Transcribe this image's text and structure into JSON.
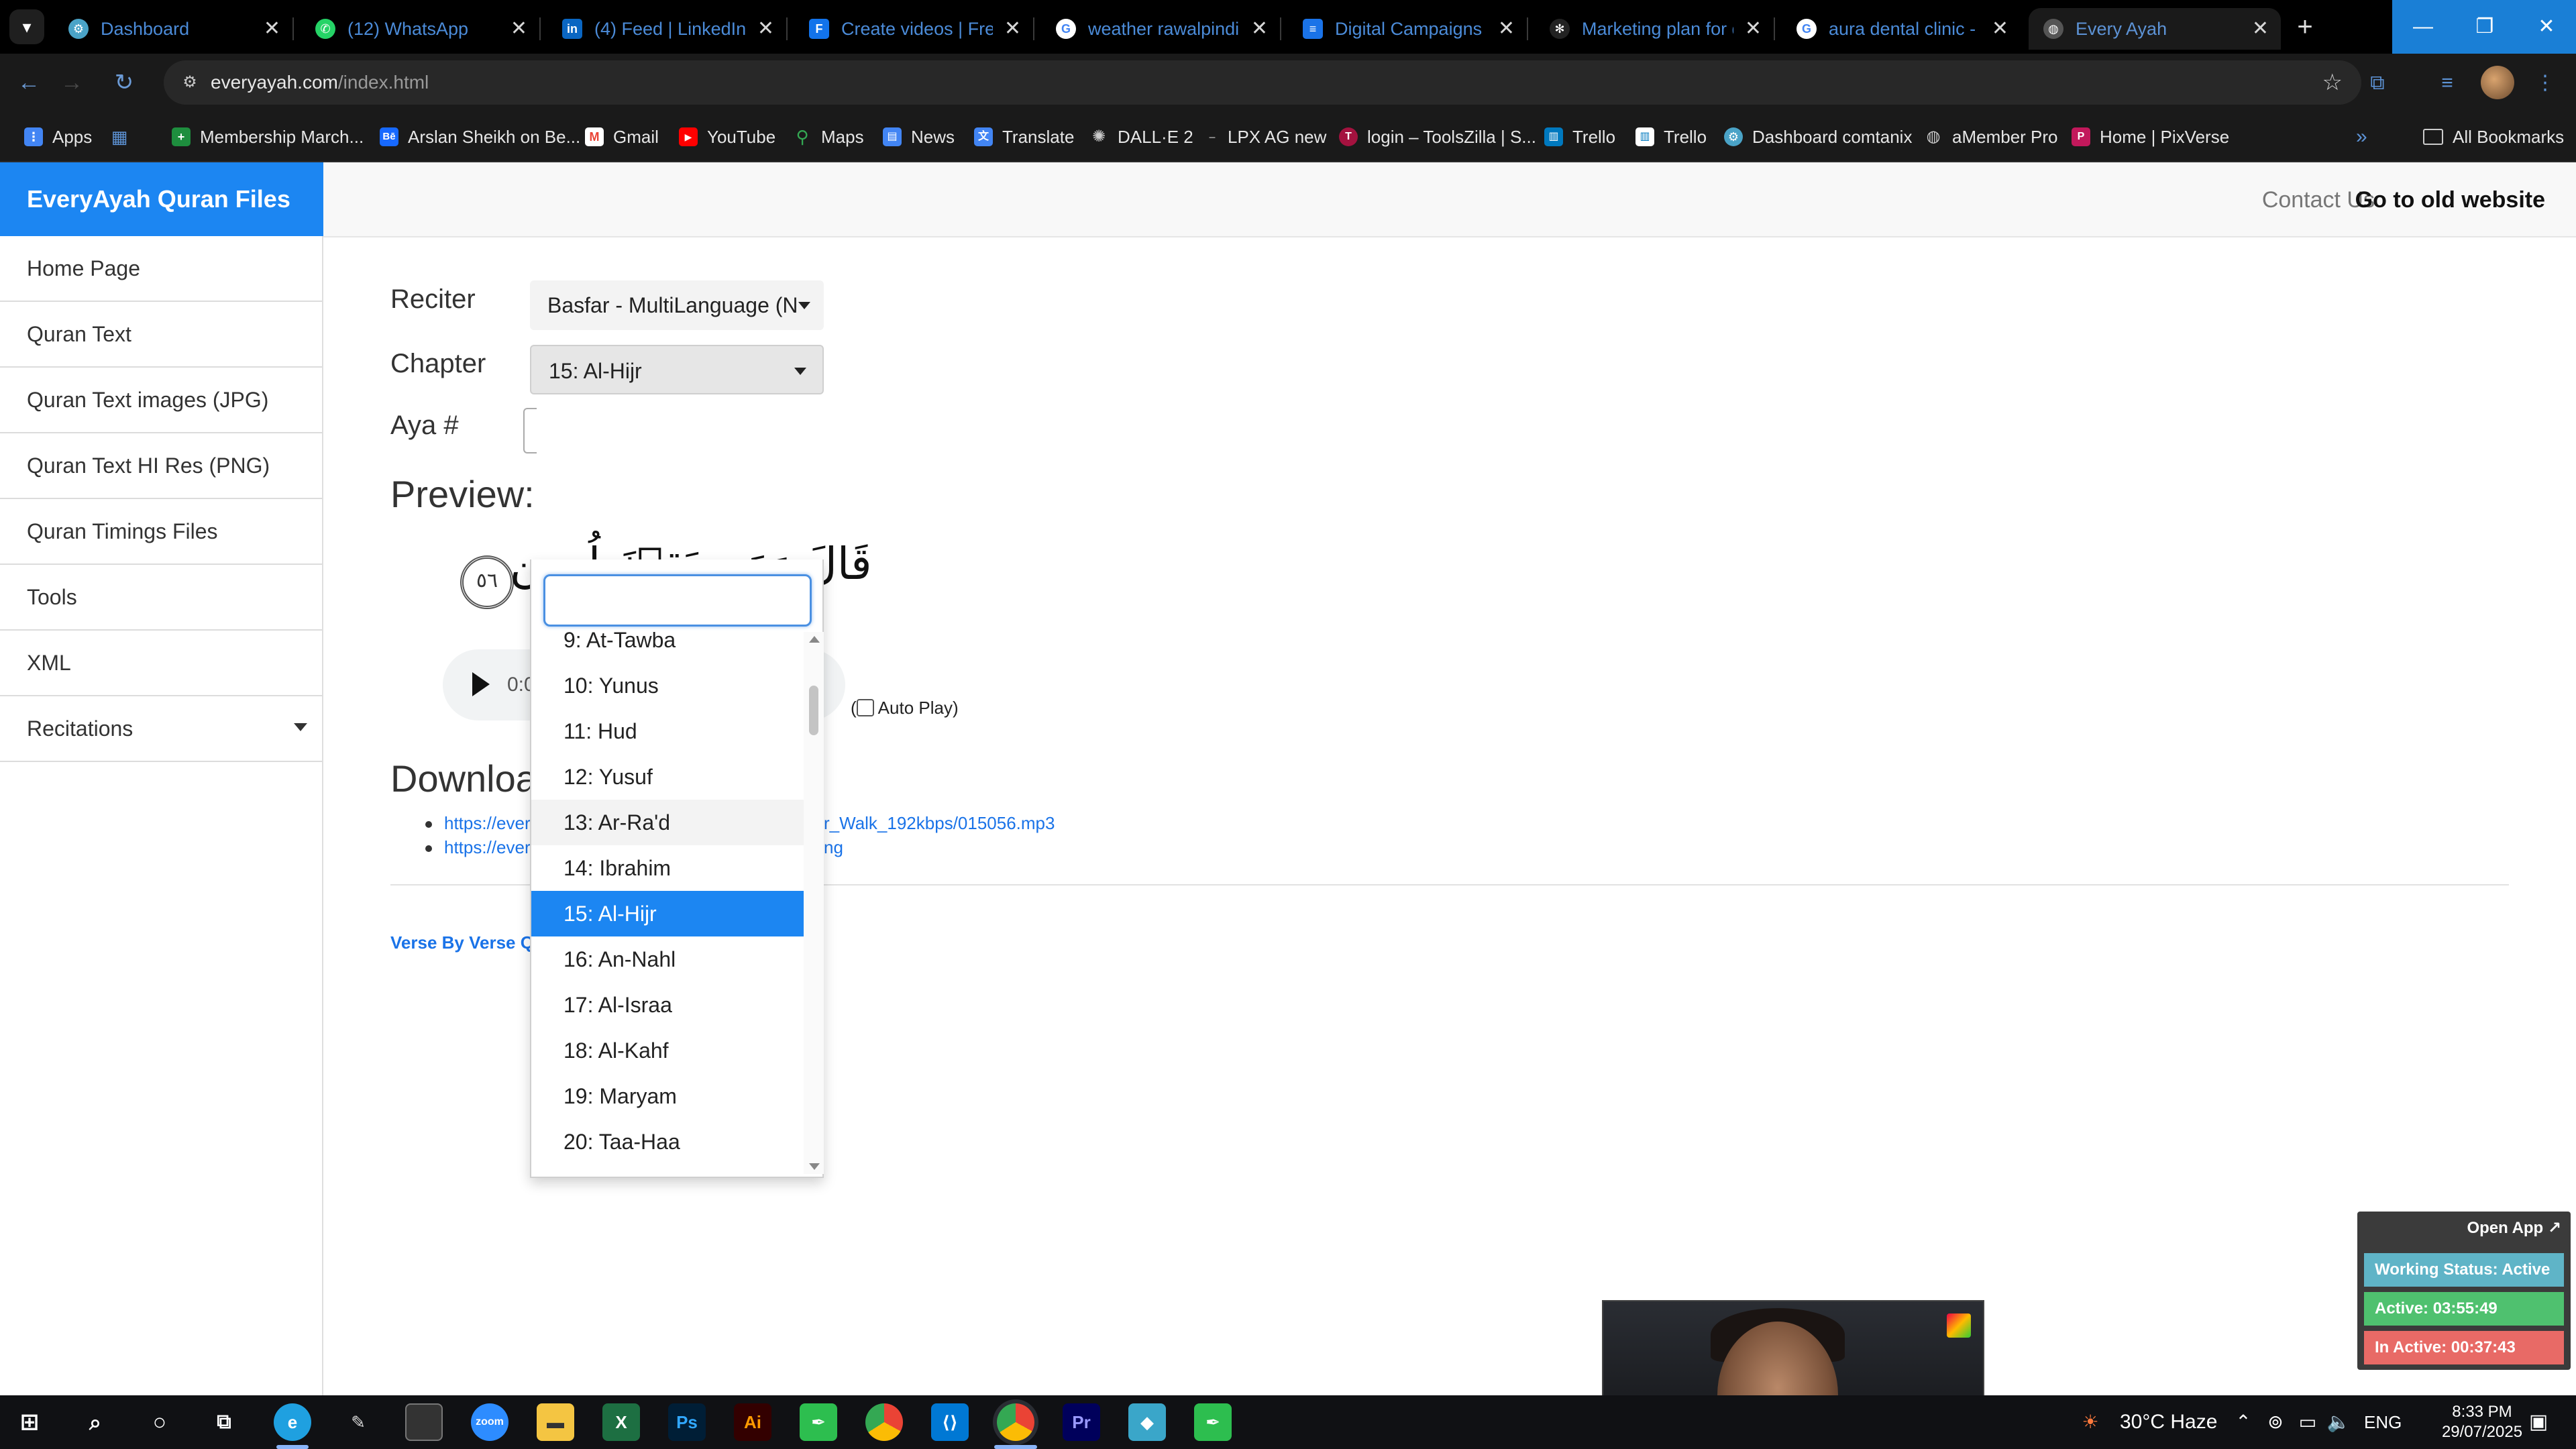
{
  "browser": {
    "tabs": [
      {
        "title": "Dashboard",
        "icon": "gear-icon",
        "color": "#4aa3c7"
      },
      {
        "title": "(12) WhatsApp",
        "icon": "whatsapp-icon",
        "color": "#25d366"
      },
      {
        "title": "(4) Feed | LinkedIn",
        "icon": "linkedin-icon",
        "color": "#0a66c2"
      },
      {
        "title": "Create videos | Freep",
        "icon": "freepik-icon",
        "color": "#1273eb"
      },
      {
        "title": "weather rawalpindi to",
        "icon": "google-icon",
        "color": "#4285f4"
      },
      {
        "title": "Digital Campaigns vs",
        "icon": "docs-icon",
        "color": "#1a73e8"
      },
      {
        "title": "Marketing plan for di",
        "icon": "openai-icon",
        "color": "#222222"
      },
      {
        "title": "aura dental clinic - G",
        "icon": "google-icon",
        "color": "#4285f4"
      },
      {
        "title": "Every Ayah",
        "icon": "globe-icon",
        "color": "#555555"
      }
    ],
    "url_host": "everyayah.com",
    "url_path": "/index.html",
    "bookmarks": [
      {
        "label": "Apps",
        "icon": "apps-icon",
        "color": "#4285f4"
      },
      {
        "label": "",
        "icon": "grid-icon",
        "color": "#5d93d6"
      },
      {
        "label": "Membership March...",
        "icon": "plus-icon",
        "color": "#1e8e3e"
      },
      {
        "label": "Arslan Sheikh on Be...",
        "icon": "behance-icon",
        "color": "#1769ff"
      },
      {
        "label": "Gmail",
        "icon": "gmail-icon",
        "color": "#ea4335"
      },
      {
        "label": "YouTube",
        "icon": "youtube-icon",
        "color": "#ff0000"
      },
      {
        "label": "Maps",
        "icon": "maps-icon",
        "color": "#34a853"
      },
      {
        "label": "News",
        "icon": "news-icon",
        "color": "#4285f4"
      },
      {
        "label": "Translate",
        "icon": "translate-icon",
        "color": "#4285f4"
      },
      {
        "label": "DALL·E 2",
        "icon": "dalle-icon",
        "color": "#444444"
      },
      {
        "label": "LPX AG new",
        "icon": "dash-icon",
        "color": "#333333"
      },
      {
        "label": "login – ToolsZilla | S...",
        "icon": "toolszilla-icon",
        "color": "#a4123f"
      },
      {
        "label": "Trello",
        "icon": "trello-icon",
        "color": "#0079bf"
      },
      {
        "label": "Trello",
        "icon": "trello-icon",
        "color": "#ffffff"
      },
      {
        "label": "Dashboard comtanix",
        "icon": "gear-icon",
        "color": "#4aa3c7"
      },
      {
        "label": "aMember Pro",
        "icon": "globe-icon",
        "color": "#666666"
      },
      {
        "label": "Home | PixVerse",
        "icon": "pixverse-icon",
        "color": "#c2185b"
      }
    ],
    "all_bookmarks": "All Bookmarks"
  },
  "site": {
    "brand": "EveryAyah Quran Files",
    "contact": "Contact Us",
    "old_site": "Go to old website",
    "sidebar": [
      "Home Page",
      "Quran Text",
      "Quran Text images (JPG)",
      "Quran Text HI Res (PNG)",
      "Quran Timings Files",
      "Tools",
      "XML",
      "Recitations"
    ]
  },
  "form": {
    "reciter_label": "Reciter",
    "reciter_value": "Basfar - MultiLanguage (N",
    "chapter_label": "Chapter",
    "chapter_value": "15: Al-Hijr",
    "aya_label": "Aya #"
  },
  "preview": {
    "heading": "Preview:",
    "arabic": "قَالَ وَمَن يَقۡنَطُ مِن",
    "verse_number": "٥٦",
    "audio_time": "0:0",
    "autoplay_label": "Auto Play)",
    "autoplay_open_paren": "("
  },
  "downloads": {
    "heading": "Downloa",
    "links": [
      {
        "left": "https://ever",
        "right": "r_Walk_192kbps/015056.mp3"
      },
      {
        "left": "https://ever",
        "right": "ng"
      }
    ],
    "verse_by_verse": "Verse By Verse Q"
  },
  "dropdown": {
    "search_value": "",
    "options": [
      "9: At-Tawba",
      "10: Yunus",
      "11: Hud",
      "12: Yusuf",
      "13: Ar-Ra'd",
      "14: Ibrahim",
      "15: Al-Hijr",
      "16: An-Nahl",
      "17: Al-Israa",
      "18: Al-Kahf",
      "19: Maryam",
      "20: Taa-Haa"
    ],
    "selected": "15: Al-Hijr",
    "hovered": "13: Ar-Ra'd"
  },
  "tracker": {
    "open_app": "Open App ↗",
    "working": "Working Status: Active",
    "active": "Active: 03:55:49",
    "inactive": "In Active: 00:37:43"
  },
  "taskbar": {
    "apps": [
      {
        "name": "start",
        "icon": "windows-icon",
        "color": "#ffffff"
      },
      {
        "name": "search",
        "icon": "search-icon",
        "color": "#ffffff"
      },
      {
        "name": "cortana",
        "icon": "circle-icon",
        "color": "#ffffff"
      },
      {
        "name": "task-view",
        "icon": "taskview-icon",
        "color": "#ffffff"
      },
      {
        "name": "edge",
        "icon": "edge-icon",
        "color": "#1fa0e0"
      },
      {
        "name": "pen",
        "icon": "pen-icon",
        "color": "#dddddd"
      },
      {
        "name": "terminal",
        "icon": "terminal-icon",
        "color": "#333333"
      },
      {
        "name": "zoom",
        "icon": "zoom-icon",
        "color": "#2d8cff"
      },
      {
        "name": "explorer",
        "icon": "folder-icon",
        "color": "#f4c542"
      },
      {
        "name": "excel",
        "icon": "excel-icon",
        "color": "#1d6f42"
      },
      {
        "name": "photoshop",
        "icon": "photoshop-icon",
        "color": "#001e36"
      },
      {
        "name": "illustrator",
        "icon": "illustrator-icon",
        "color": "#330000"
      },
      {
        "name": "app-green-1",
        "icon": "pen-tool-icon",
        "color": "#2dbe4f"
      },
      {
        "name": "chrome",
        "icon": "chrome-icon",
        "color": "#4285f4"
      },
      {
        "name": "vscode",
        "icon": "vscode-icon",
        "color": "#0078d4"
      },
      {
        "name": "chrome-active",
        "icon": "chrome-icon",
        "color": "#4285f4"
      },
      {
        "name": "premiere",
        "icon": "premiere-icon",
        "color": "#00005b"
      },
      {
        "name": "app-teal",
        "icon": "diamond-icon",
        "color": "#3aa6c9"
      },
      {
        "name": "app-green-2",
        "icon": "pen-tool-icon",
        "color": "#2dbe4f"
      }
    ],
    "weather": "30°C  Haze",
    "language": "ENG",
    "time": "8:33 PM",
    "date": "29/07/2025"
  }
}
